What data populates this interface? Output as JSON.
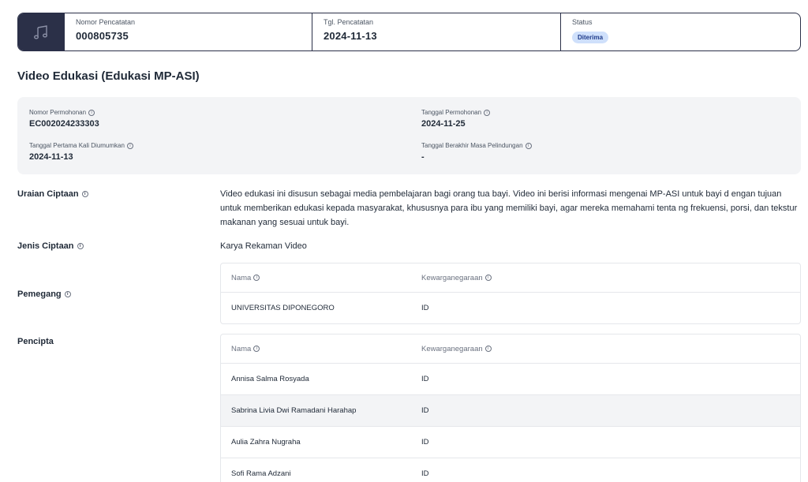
{
  "header": {
    "icon": "music-note-icon",
    "nomor_pencatatan_label": "Nomor Pencatatan",
    "nomor_pencatatan_value": "000805735",
    "tgl_pencatatan_label": "Tgl. Pencatatan",
    "tgl_pencatatan_value": "2024-11-13",
    "status_label": "Status",
    "status_value": "Diterima"
  },
  "title": "Video Edukasi (Edukasi MP-ASI)",
  "info": {
    "nomor_permohonan_label": "Nomor Permohonan",
    "nomor_permohonan_value": "EC002024233303",
    "tanggal_permohonan_label": "Tanggal Permohonan",
    "tanggal_permohonan_value": "2024-11-25",
    "tanggal_diumumkan_label": "Tanggal Pertama Kali Diumumkan",
    "tanggal_diumumkan_value": "2024-11-13",
    "tanggal_berakhir_label": "Tanggal Berakhir Masa Pelindungan",
    "tanggal_berakhir_value": "-"
  },
  "uraian": {
    "label": "Uraian Ciptaan",
    "value": "Video edukasi ini disusun sebagai media pembelajaran bagi orang tua bayi. Video ini berisi informasi mengenai MP-ASI untuk bayi d engan tujuan untuk memberikan edukasi kepada masyarakat, khususnya para ibu yang memiliki bayi, agar mereka memahami tenta ng frekuensi, porsi, dan tekstur makanan yang sesuai untuk bayi."
  },
  "jenis": {
    "label": "Jenis Ciptaan",
    "value": "Karya Rekaman Video"
  },
  "pemegang": {
    "label": "Pemegang",
    "col_nama": "Nama",
    "col_kewarganegaraan": "Kewarganegaraan",
    "rows": [
      {
        "nama": "UNIVERSITAS DIPONEGORO",
        "kewarganegaraan": "ID"
      }
    ]
  },
  "pencipta": {
    "label": "Pencipta",
    "col_nama": "Nama",
    "col_kewarganegaraan": "Kewarganegaraan",
    "rows": [
      {
        "nama": "Annisa Salma Rosyada",
        "kewarganegaraan": "ID"
      },
      {
        "nama": "Sabrina Livia Dwi Ramadani Harahap",
        "kewarganegaraan": "ID"
      },
      {
        "nama": "Aulia Zahra Nugraha",
        "kewarganegaraan": "ID"
      },
      {
        "nama": "Sofi Rama Adzani",
        "kewarganegaraan": "ID"
      }
    ]
  },
  "colors": {
    "header_dark": "#2b3048",
    "badge_bg": "#cfe0fb",
    "panel_bg": "#f3f4f6"
  }
}
